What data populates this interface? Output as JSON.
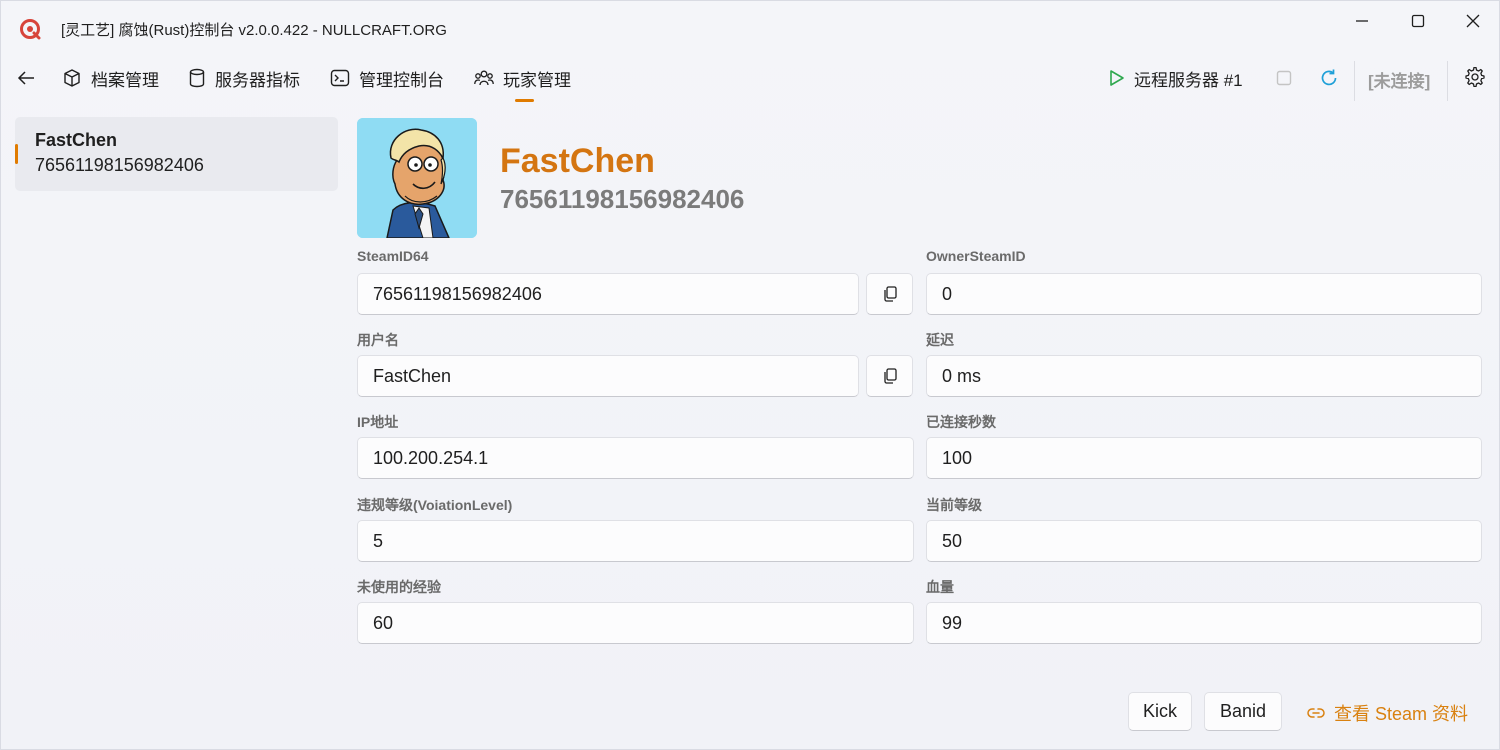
{
  "window": {
    "title": "[灵工艺] 腐蚀(Rust)控制台 v2.0.0.422 - NULLCRAFT.ORG"
  },
  "toolbar": {
    "nav": [
      {
        "label": "档案管理",
        "icon": "cube-icon"
      },
      {
        "label": "服务器指标",
        "icon": "database-icon"
      },
      {
        "label": "管理控制台",
        "icon": "console-icon"
      },
      {
        "label": "玩家管理",
        "icon": "people-icon",
        "active": true
      }
    ],
    "server_label": "远程服务器 #1",
    "connection_status": "[未连接]"
  },
  "players": [
    {
      "name": "FastChen",
      "steam_id": "76561198156982406",
      "selected": true
    }
  ],
  "profile": {
    "name": "FastChen",
    "steam_id": "76561198156982406",
    "fields": {
      "steamid64": {
        "label": "SteamID64",
        "value": "76561198156982406"
      },
      "owner_steamid": {
        "label": "OwnerSteamID",
        "value": "0"
      },
      "username": {
        "label": "用户名",
        "value": "FastChen"
      },
      "latency": {
        "label": "延迟",
        "value": "0 ms"
      },
      "ip": {
        "label": "IP地址",
        "value": "100.200.254.1"
      },
      "connected_seconds": {
        "label": "已连接秒数",
        "value": "100"
      },
      "violation_level": {
        "label": "违规等级(VoiationLevel)",
        "value": "5"
      },
      "current_level": {
        "label": "当前等级",
        "value": "50"
      },
      "unspent_xp": {
        "label": "未使用的经验",
        "value": "60"
      },
      "health": {
        "label": "血量",
        "value": "99"
      }
    }
  },
  "actions": {
    "kick": "Kick",
    "ban": "Banid",
    "steam_profile": "查看 Steam 资料"
  },
  "colors": {
    "accent": "#e07b00",
    "name": "#d47511",
    "play": "#2fa84f",
    "refresh": "#1fa0d8"
  }
}
